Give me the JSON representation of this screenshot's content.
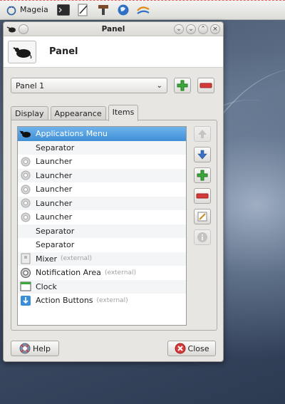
{
  "top_panel": {
    "menu_label": "Mageia",
    "launchers": [
      "terminal-icon",
      "text-editor-icon",
      "settings-brush-icon",
      "web-browser-icon",
      "file-manager-icon"
    ]
  },
  "window": {
    "title": "Panel",
    "header_title": "Panel",
    "panel_select": {
      "selected": "Panel 1"
    },
    "tabs": [
      {
        "label": "Display",
        "active": false
      },
      {
        "label": "Appearance",
        "active": false
      },
      {
        "label": "Items",
        "active": true
      }
    ],
    "items": [
      {
        "label": "Applications Menu",
        "external": "",
        "icon": "mouse-icon",
        "selected": true
      },
      {
        "label": "Separator",
        "external": "",
        "icon": "",
        "selected": false
      },
      {
        "label": "Launcher",
        "external": "",
        "icon": "gear-icon",
        "selected": false
      },
      {
        "label": "Launcher",
        "external": "",
        "icon": "gear-icon",
        "selected": false
      },
      {
        "label": "Launcher",
        "external": "",
        "icon": "gear-icon",
        "selected": false
      },
      {
        "label": "Launcher",
        "external": "",
        "icon": "gear-icon",
        "selected": false
      },
      {
        "label": "Launcher",
        "external": "",
        "icon": "gear-icon",
        "selected": false
      },
      {
        "label": "Separator",
        "external": "",
        "icon": "",
        "selected": false
      },
      {
        "label": "Separator",
        "external": "",
        "icon": "",
        "selected": false
      },
      {
        "label": "Mixer",
        "external": "(external)",
        "icon": "mixer-icon",
        "selected": false
      },
      {
        "label": "Notification Area",
        "external": "(external)",
        "icon": "notification-icon",
        "selected": false
      },
      {
        "label": "Clock",
        "external": "",
        "icon": "clock-icon",
        "selected": false
      },
      {
        "label": "Action Buttons",
        "external": "(external)",
        "icon": "action-icon",
        "selected": false
      }
    ],
    "help_label": "Help",
    "close_label": "Close"
  },
  "colors": {
    "selection": "#4a97dc",
    "add_green": "#3aa83a",
    "remove_red": "#d43c3c"
  }
}
